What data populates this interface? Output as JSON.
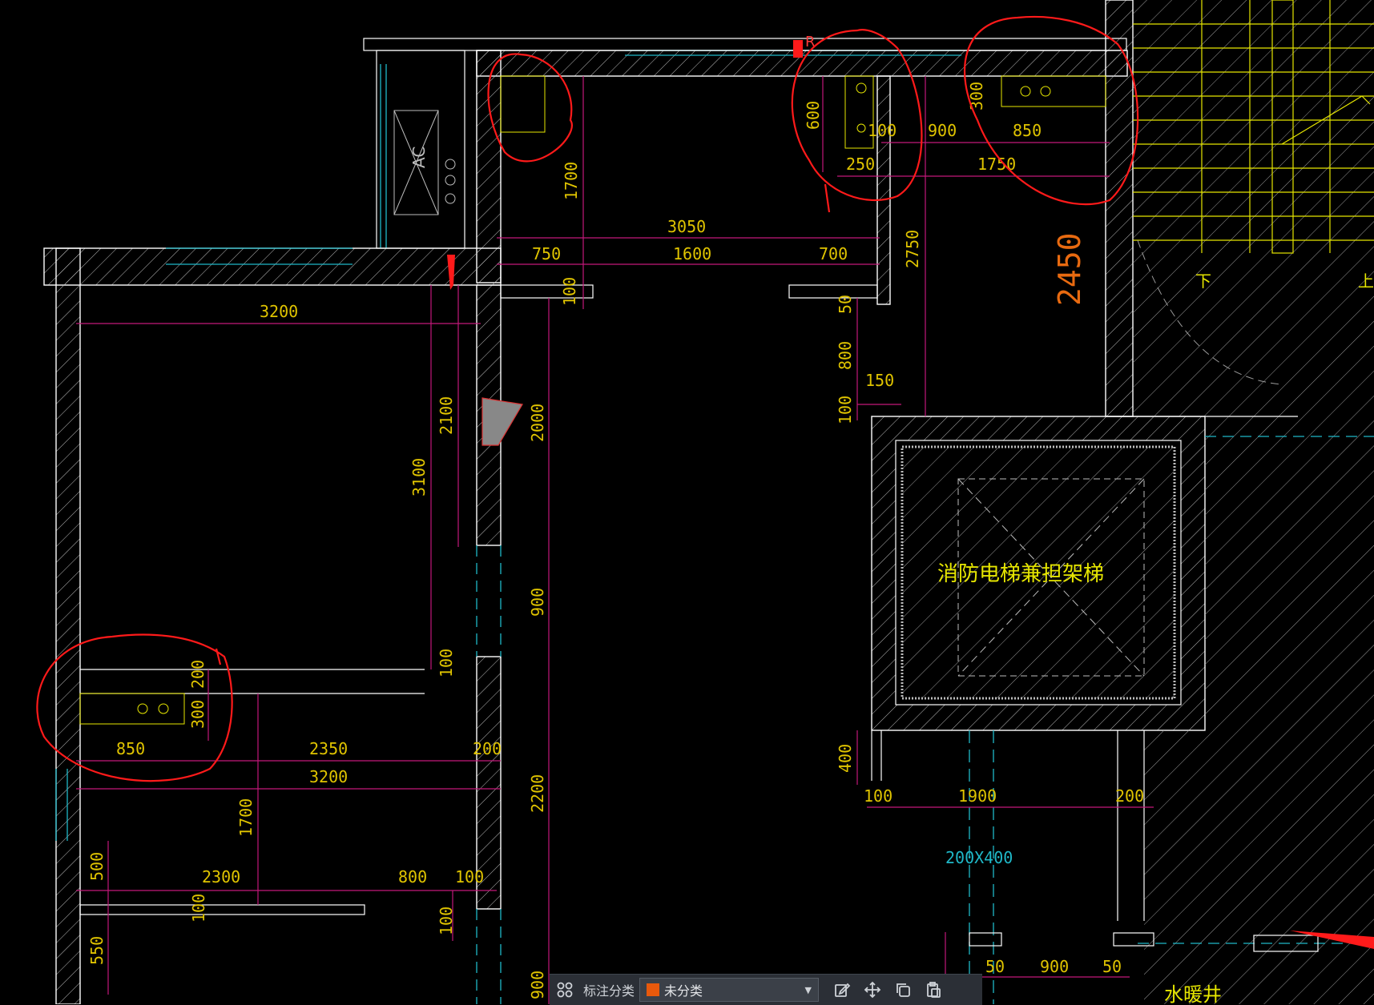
{
  "drawing": {
    "labels": {
      "elevator": "消防电梯兼担架梯",
      "shaft": "水暖井",
      "duct": "200X400",
      "big_dim": "2450",
      "up": "上",
      "down": "下",
      "ac": "AC",
      "r": "R"
    },
    "dimensions": {
      "d3050": "3050",
      "d750": "750",
      "d1600": "1600",
      "d700": "700",
      "d1700top": "1700",
      "d600": "600",
      "d100a": "100",
      "d250": "250",
      "d900top": "900",
      "d300top": "300",
      "d850top": "850",
      "d1750": "1750",
      "d2750": "2750",
      "d3200top": "3200",
      "d2100": "2100",
      "d3100": "3100",
      "d2000": "2000",
      "d100b": "100",
      "d50a": "50",
      "d800a": "800",
      "d150": "150",
      "d100c": "100",
      "d900mid": "900",
      "d100d": "100",
      "d200a": "200",
      "d300b": "300",
      "d850b": "850",
      "d2350": "2350",
      "d200b": "200",
      "d3200b": "3200",
      "d1700b": "1700",
      "d2200": "2200",
      "d400": "400",
      "d100e": "100",
      "d1900": "1900",
      "d200c": "200",
      "d500": "500",
      "d2300": "2300",
      "d800b": "800",
      "d100f": "100",
      "d100g": "100",
      "d100h": "100",
      "d550": "550",
      "d900bot": "900",
      "d50b": "50",
      "d900c": "900",
      "d50c": "50"
    }
  },
  "toolbar": {
    "category_label": "标注分类",
    "category_value": "未分类",
    "swatch_color": "#e8590c"
  },
  "colors": {
    "wall": "#ffffff",
    "dim_line": "#c2187a",
    "dim_text": "#e0c400",
    "cyan": "#1fb8c8",
    "annotation": "#ff1a1a",
    "stair": "#e6e600"
  }
}
